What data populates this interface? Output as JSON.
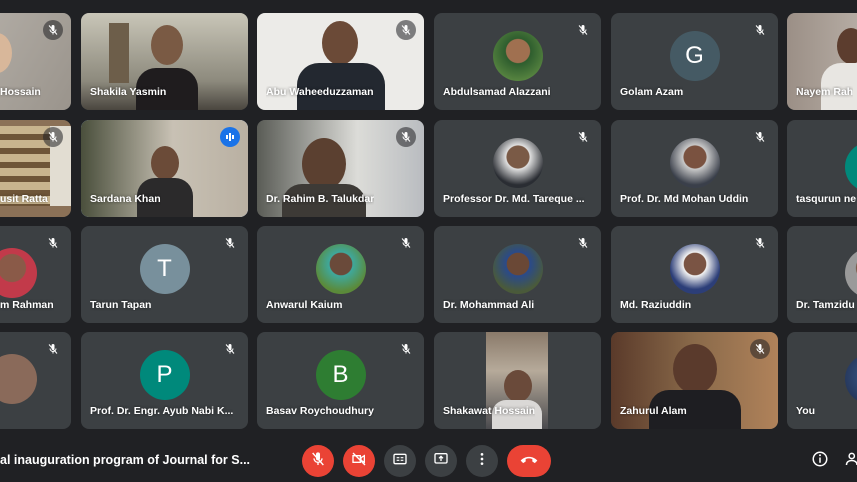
{
  "participants": {
    "hossain": "Hossain",
    "shakila": "Shakila Yasmin",
    "abu": "Abu Waheeduzzaman",
    "abdulsamad": "Abdulsamad Alazzani",
    "golam": "Golam Azam",
    "golam_initial": "G",
    "nayem": "Nayem Rah",
    "susit": "usit Ratta",
    "sardana": "Sardana Khan",
    "rahim": "Dr. Rahim B. Talukdar",
    "tareque": "Professor Dr. Md. Tareque ...",
    "mohan": "Prof. Dr. Md Mohan Uddin",
    "tasqurun": "tasqurun ne",
    "rahman": "m Rahman",
    "tarun": "Tarun Tapan",
    "tarun_initial": "T",
    "anwarul": "Anwarul Kaium",
    "mohammad": "Dr. Mohammad Ali",
    "raziuddin": "Md. Raziuddin",
    "tamzid": "Dr. Tamzidu",
    "ayub": "Prof. Dr. Engr. Ayub Nabi K...",
    "ayub_initial": "P",
    "basav": "Basav Roychoudhury",
    "basav_initial": "B",
    "shakawat": "Shakawat Hossain",
    "zahurul": "Zahurul Alam",
    "you": "You"
  },
  "meeting": {
    "title": "al inauguration program of Journal for S..."
  },
  "controls": {
    "mic": "mic-off-icon",
    "camera": "camera-off-icon",
    "captions": "captions-icon",
    "present": "present-screen-icon",
    "more": "more-options-icon",
    "leave": "leave-call-icon",
    "info": "info-icon",
    "people": "people-icon"
  },
  "colors": {
    "tile_bg": "#3c4043",
    "page_bg": "#202124",
    "leave_red": "#ea4335",
    "speaking_blue": "#1a73e8",
    "avatar_golam": "#455a64",
    "avatar_tarun": "#78909c",
    "avatar_ayub": "#00897b",
    "avatar_basav": "#2e7d32"
  }
}
